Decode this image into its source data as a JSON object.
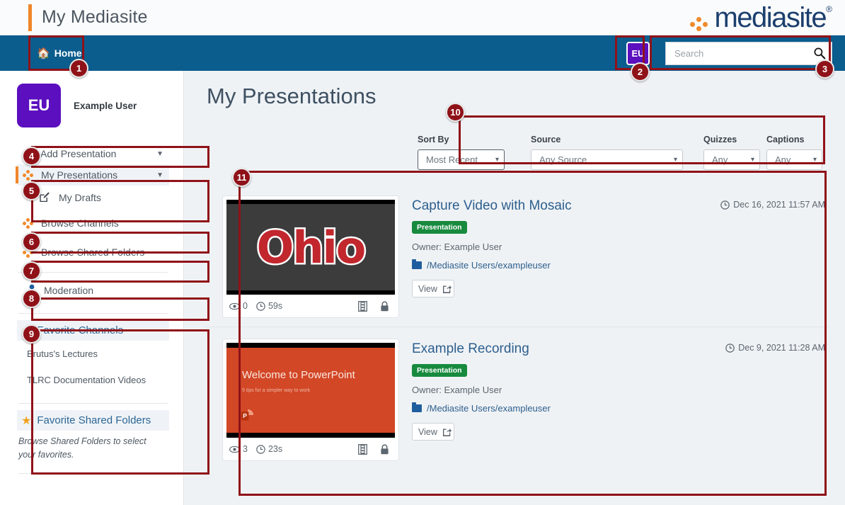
{
  "header": {
    "app_title": "My Mediasite",
    "logo_text": "mediasite",
    "logo_reg": "®"
  },
  "navbar": {
    "home_label": "Home",
    "home_icon": "home-icon",
    "user_initials": "EU",
    "search_placeholder": "Search",
    "search_value": "",
    "search_icon": "search-icon"
  },
  "sidebar": {
    "user": {
      "initials": "EU",
      "name": "Example User"
    },
    "items": [
      {
        "label": "Add Presentation",
        "icon": "plus-circle-icon",
        "caret": true
      },
      {
        "label": "My Presentations",
        "icon": "mediasite-dots-icon",
        "caret": true
      },
      {
        "label": "My Drafts",
        "icon": "edit-pencil-icon"
      },
      {
        "label": "Browse Channels",
        "icon": "mediasite-dots-icon"
      },
      {
        "label": "Browse Shared Folders",
        "icon": "mediasite-dots-icon"
      },
      {
        "label": "Moderation",
        "icon": "person-icon"
      }
    ],
    "favorite_channels": {
      "heading": "Favorite Channels",
      "items": [
        "Brutus's Lectures",
        "TLRC Documentation Videos"
      ]
    },
    "favorite_shared_folders": {
      "heading": "Favorite Shared Folders",
      "note": "Browse Shared Folders to select your favorites."
    }
  },
  "main": {
    "page_title": "My Presentations",
    "filters": [
      {
        "label": "Sort By",
        "value": "Most Recent"
      },
      {
        "label": "Source",
        "value": "Any Source"
      },
      {
        "label": "Quizzes",
        "value": "Any"
      },
      {
        "label": "Captions",
        "value": "Any"
      }
    ],
    "results": [
      {
        "title": "Capture Video with Mosaic",
        "date": "Dec 16, 2021 11:57 AM",
        "badge": "Presentation",
        "owner": "Owner: Example User",
        "path": "/Mediasite Users/exampleuser",
        "view_label": "View",
        "views": "0",
        "duration": "59s",
        "thumb_kind": "ohio",
        "thumb_text": "Ohio"
      },
      {
        "title": "Example Recording",
        "date": "Dec 9, 2021 11:28 AM",
        "badge": "Presentation",
        "owner": "Owner: Example User",
        "path": "/Mediasite Users/exampleuser",
        "view_label": "View",
        "views": "3",
        "duration": "23s",
        "thumb_kind": "ppt",
        "thumb_text": "Welcome to PowerPoint",
        "thumb_subtext": "5 tips for a simpler way to work"
      }
    ]
  },
  "annotations": {
    "color": "#8f1218",
    "numbers": [
      "1",
      "2",
      "3",
      "4",
      "5",
      "6",
      "7",
      "8",
      "9",
      "10",
      "11"
    ]
  }
}
